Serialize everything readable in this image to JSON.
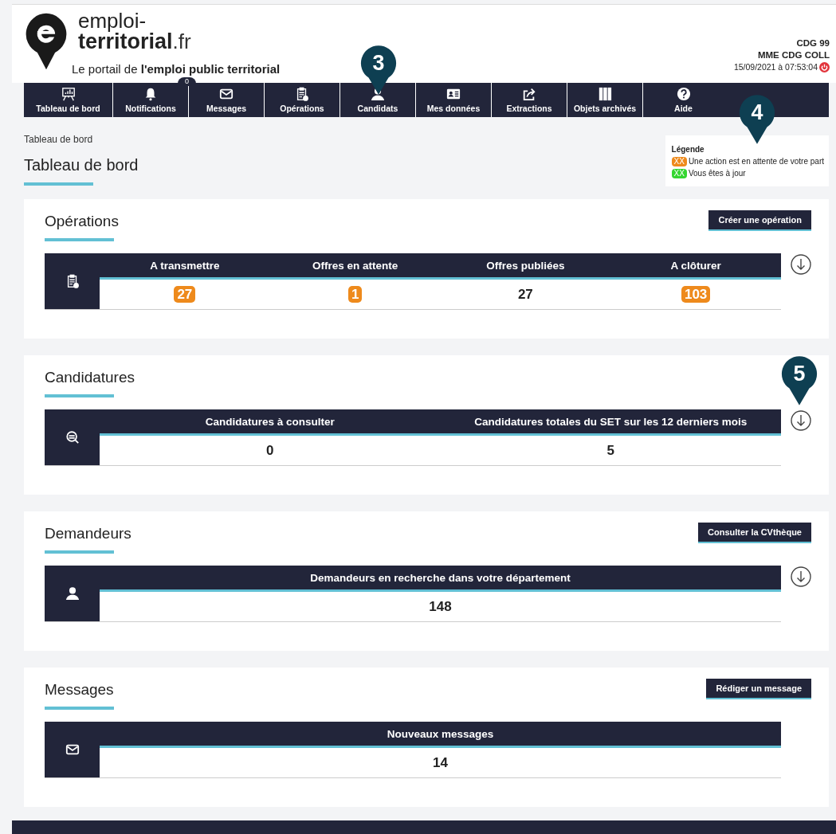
{
  "header": {
    "logo_line_1": "emploi-",
    "logo_line_2": "territorial",
    "logo_suffix": ".fr",
    "tagline": "Le portail de **l'emploi public territorial**",
    "org": "CDG 99",
    "user": "MME CDG COLL",
    "timestamp": "15/09/2021 à 07:53:04"
  },
  "nav": [
    {
      "label": "Tableau de bord",
      "kind": "chart",
      "selected": false
    },
    {
      "label": "Notifications",
      "kind": "bell",
      "selected": false,
      "badge": "0"
    },
    {
      "label": "Messages",
      "kind": "mail",
      "selected": false
    },
    {
      "label": "Opérations",
      "kind": "clipboard",
      "selected": false
    },
    {
      "label": "Candidats",
      "kind": "person",
      "selected": false
    },
    {
      "label": "Mes données",
      "kind": "idcard",
      "selected": false
    },
    {
      "label": "Extractions",
      "kind": "share",
      "selected": false
    },
    {
      "label": "Objets archivés",
      "kind": "binders",
      "selected": false
    },
    {
      "label": "Aide",
      "kind": "help",
      "selected": false
    }
  ],
  "breadcrumb": "Tableau de bord",
  "page_title": "Tableau de bord",
  "legend": {
    "title": "Légende",
    "items": [
      {
        "badge": "XX",
        "text": "Une action est en attente de votre part",
        "color": "#ee8a1c"
      },
      {
        "badge": "XX",
        "text": "Vous êtes à jour",
        "color": "#35d631"
      }
    ]
  },
  "sections": [
    {
      "title": "Opérations",
      "kind": "clipboard",
      "button": "Créer une opération",
      "download": true,
      "columns": [
        {
          "label": "A transmettre",
          "value": "27",
          "pending": true
        },
        {
          "label": "Offres en attente",
          "value": "1",
          "pending": true
        },
        {
          "label": "Offres publiées",
          "value": "27",
          "pending": false
        },
        {
          "label": "A clôturer",
          "value": "103",
          "pending": true
        }
      ]
    },
    {
      "title": "Candidatures",
      "kind": "search",
      "download": true,
      "columns": [
        {
          "label": "Candidatures à consulter",
          "value": "0",
          "pending": false
        },
        {
          "label": "Candidatures totales du SET sur les 12 derniers mois",
          "value": "5",
          "pending": false
        }
      ]
    },
    {
      "title": "Demandeurs",
      "kind": "person",
      "button": "Consulter la CVthèque",
      "download": true,
      "columns": [
        {
          "label": "Demandeurs en recherche dans votre département",
          "value": "148",
          "pending": false
        }
      ]
    },
    {
      "title": "Messages",
      "kind": "mail",
      "button": "Rédiger un message",
      "download": false,
      "columns": [
        {
          "label": "Nouveaux messages",
          "value": "14",
          "pending": false
        }
      ]
    }
  ],
  "callouts": [
    "3",
    "4",
    "5"
  ]
}
